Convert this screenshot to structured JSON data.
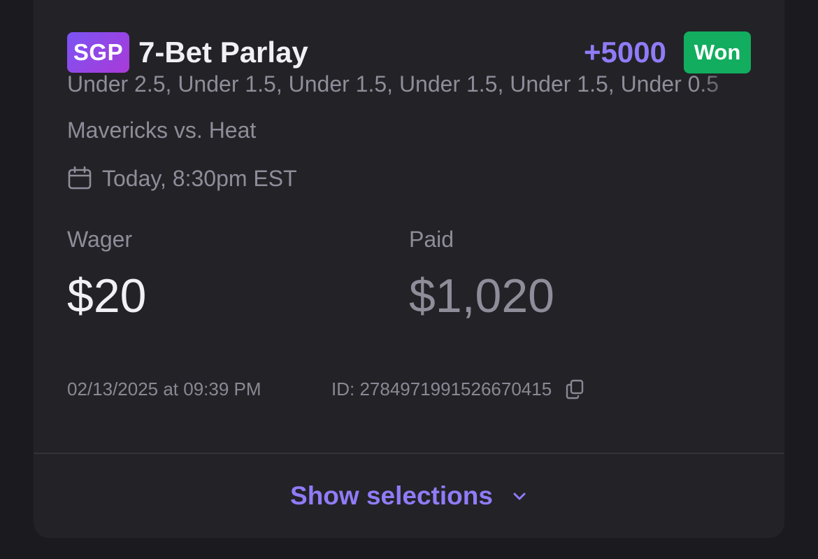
{
  "bet": {
    "badge": "SGP",
    "title": "7-Bet Parlay",
    "odds": "+5000",
    "status": "Won",
    "legs": "Under 2.5, Under 1.5, Under 1.5, Under 1.5, Under 1.5, Under 0.5",
    "matchup": "Mavericks vs. Heat",
    "game_time": "Today, 8:30pm EST",
    "wager_label": "Wager",
    "wager_amount": "$20",
    "paid_label": "Paid",
    "paid_amount": "$1,020",
    "placed_at": "02/13/2025 at 09:39 PM",
    "id_text": "ID: 2784971991526670415"
  },
  "footer": {
    "show_selections_label": "Show selections"
  },
  "icons": {
    "calendar": "calendar-icon",
    "copy": "copy-icon",
    "chevron": "chevron-down-icon"
  },
  "colors": {
    "background": "#1b1a1e",
    "card": "#232227",
    "accent": "#8f7cf7",
    "won": "#12ad5e",
    "badge_gradient_start": "#7b54f4",
    "badge_gradient_end": "#a93ad8",
    "muted_text": "#8f8d99",
    "primary_text": "#f1f0f5"
  }
}
